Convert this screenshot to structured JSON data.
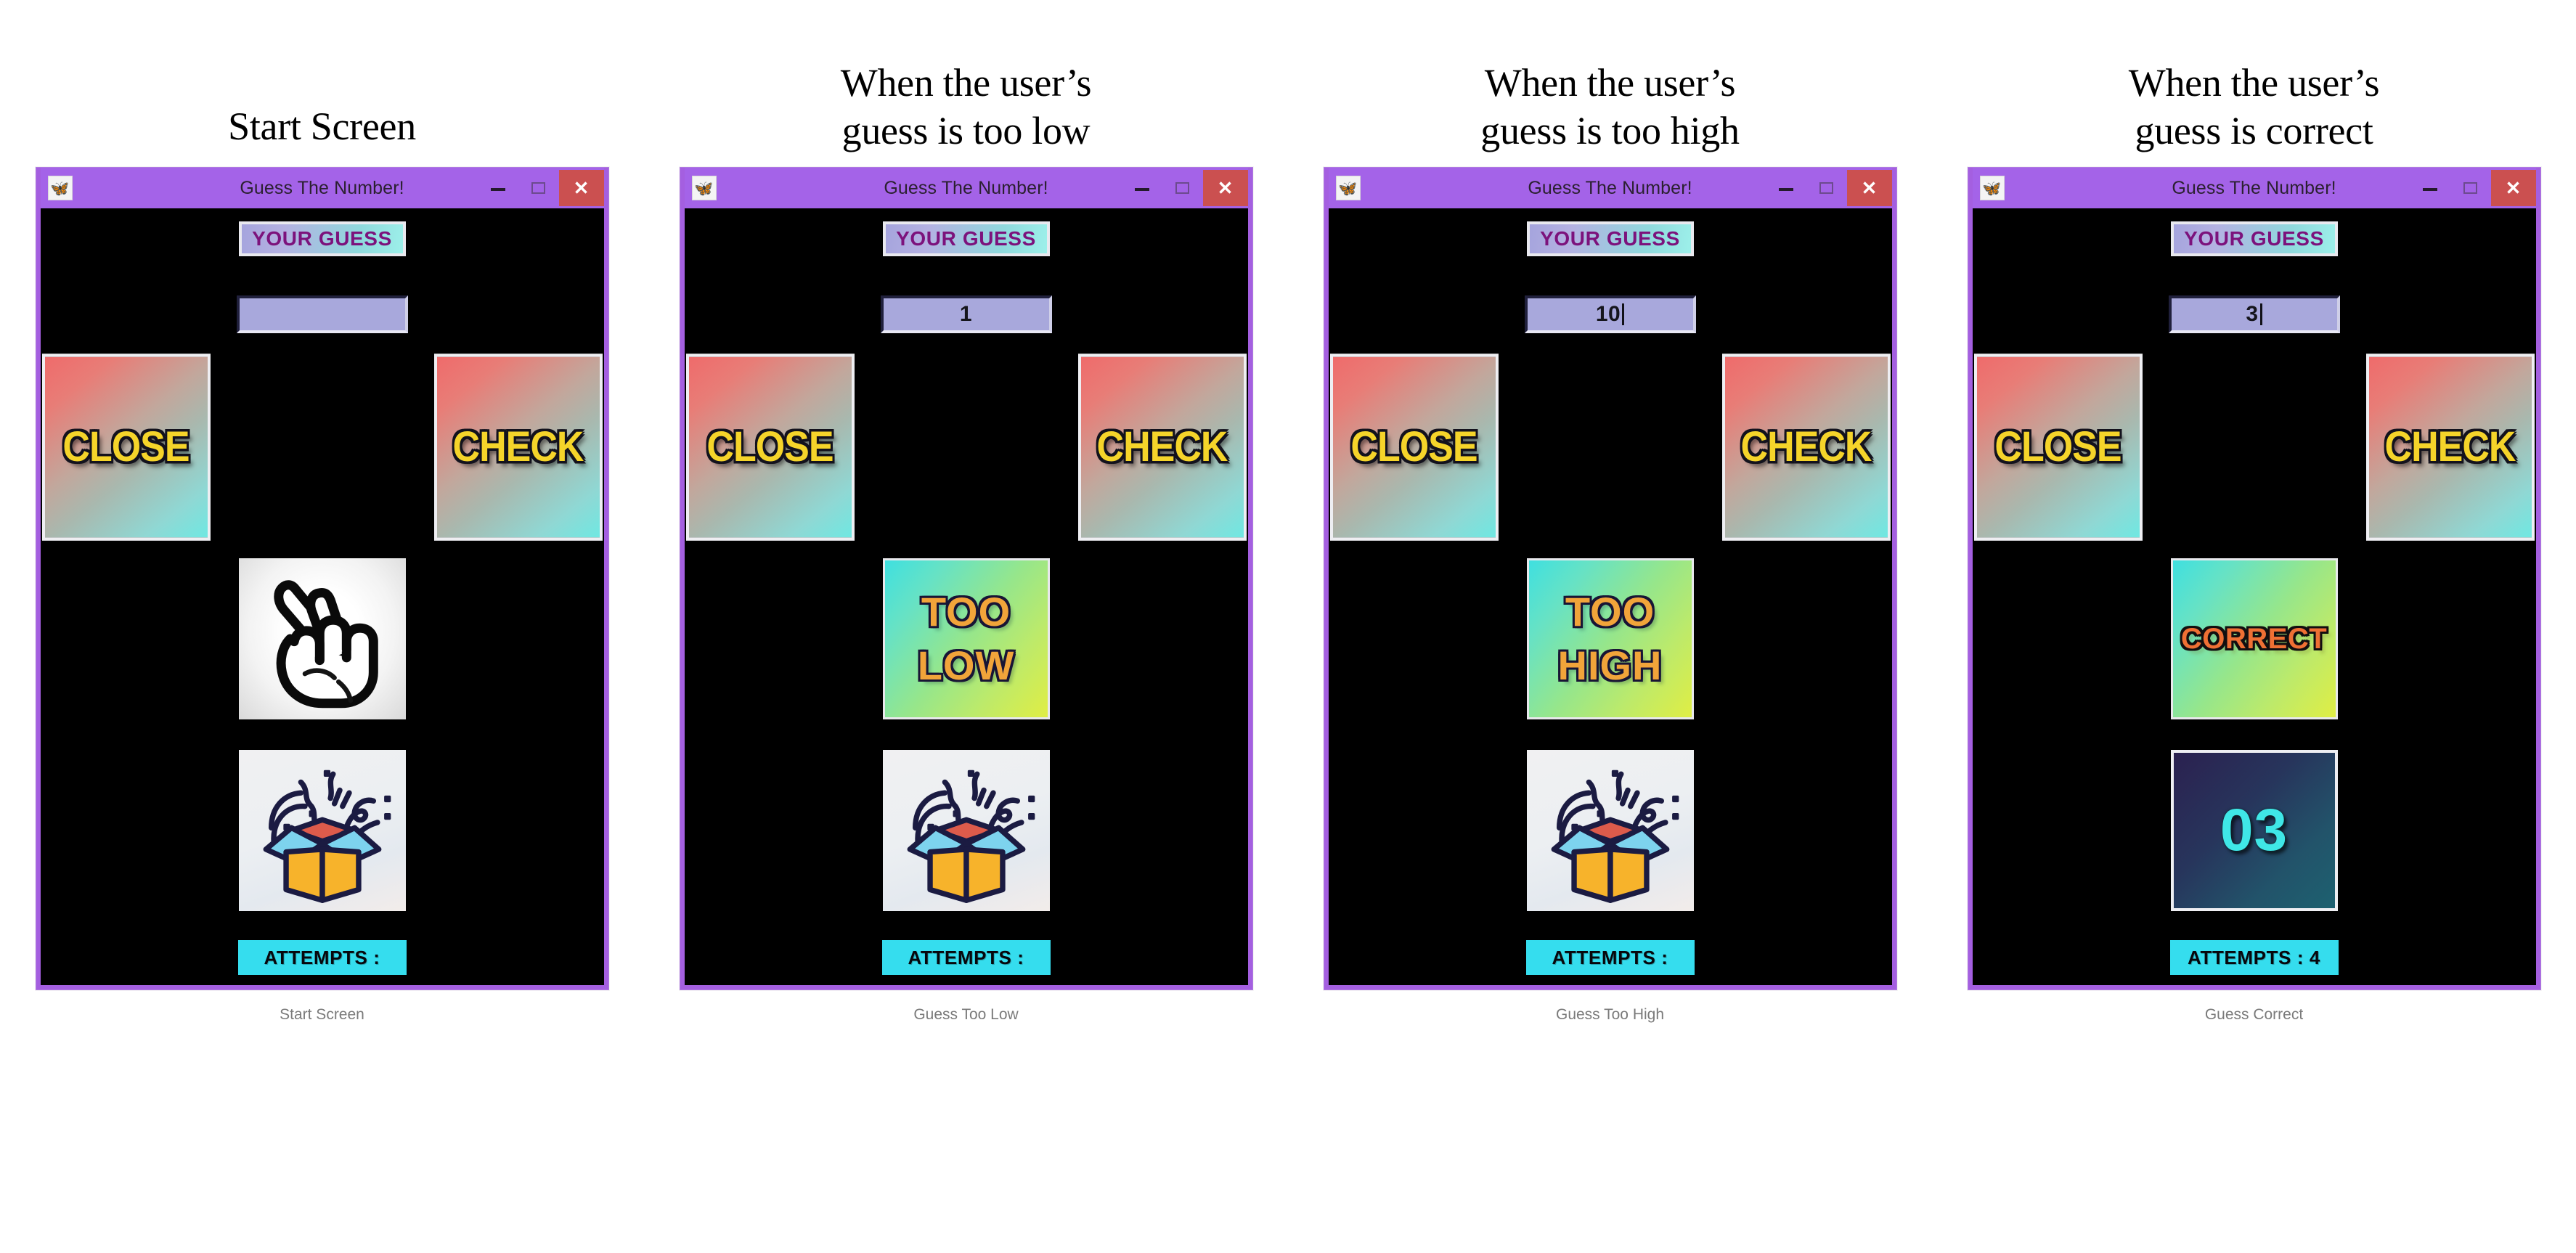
{
  "document": {
    "background": "#ffffff",
    "accent_purple": "#a463e8",
    "accent_cyan": "#35ddee",
    "button_yellow": "#f5d42a",
    "feedback_orange": "#f1a43a",
    "correct_orange": "#ef7034",
    "answer_cyan": "#3fe7e7"
  },
  "window_chrome": {
    "title": "Guess The Number!",
    "app_icon": "butterfly-app-icon",
    "minimize_label": "–",
    "maximize_label": "❑",
    "close_label": "✕"
  },
  "common": {
    "guess_label": "YOUR GUESS",
    "close_button": "CLOSE",
    "check_button": "CHECK",
    "attempts_prefix": "ATTEMPTS :"
  },
  "panels": [
    {
      "heading": "Start Screen",
      "heading_lines": [
        "Start Screen"
      ],
      "caption": "Start Screen",
      "input_value": "",
      "input_placeholder": "",
      "caret_visible": false,
      "middle": {
        "kind": "image",
        "icon": "crossed-fingers-icon",
        "text": ""
      },
      "bottom": {
        "kind": "image",
        "icon": "gift-box-confetti-icon",
        "text": ""
      },
      "attempts_text": "ATTEMPTS :"
    },
    {
      "heading": "When the user’s guess is too low",
      "heading_lines": [
        "When the user’s",
        "guess is too low"
      ],
      "caption": "Guess Too Low",
      "input_value": "1",
      "input_placeholder": "",
      "caret_visible": false,
      "middle": {
        "kind": "feedback",
        "icon": "too-low-badge",
        "lines": [
          "TOO",
          "LOW"
        ]
      },
      "bottom": {
        "kind": "image",
        "icon": "gift-box-confetti-icon",
        "text": ""
      },
      "attempts_text": "ATTEMPTS :"
    },
    {
      "heading": "When the user’s guess is too high",
      "heading_lines": [
        "When the user’s",
        "guess is too high"
      ],
      "caption": "Guess Too High",
      "input_value": "10",
      "input_placeholder": "",
      "caret_visible": true,
      "middle": {
        "kind": "feedback",
        "icon": "too-high-badge",
        "lines": [
          "TOO",
          "HIGH"
        ]
      },
      "bottom": {
        "kind": "image",
        "icon": "gift-box-confetti-icon",
        "text": ""
      },
      "attempts_text": "ATTEMPTS :"
    },
    {
      "heading": "When the user’s guess is correct",
      "heading_lines": [
        "When the user’s",
        "guess is correct"
      ],
      "caption": "Guess Correct",
      "input_value": "3",
      "input_placeholder": "",
      "caret_visible": true,
      "middle": {
        "kind": "feedback-one",
        "icon": "correct-badge",
        "lines": [
          "CORRECT"
        ]
      },
      "bottom": {
        "kind": "answer",
        "icon": "secret-number-display",
        "text": "03"
      },
      "attempts_text": "ATTEMPTS : 4"
    }
  ]
}
